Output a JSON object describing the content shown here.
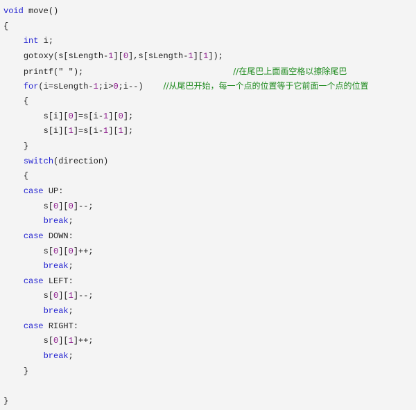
{
  "colors": {
    "background": "#f4f4f4",
    "keyword": "#1f1fd0",
    "number": "#8b1a8b",
    "comment": "#1e8a1e",
    "text": "#222222"
  },
  "code": {
    "language": "c",
    "lines": [
      {
        "indent": "",
        "tokens": [
          {
            "t": "kw",
            "v": "void"
          },
          {
            "t": "plain",
            "v": " move()"
          }
        ]
      },
      {
        "indent": "",
        "tokens": [
          {
            "t": "plain",
            "v": "{"
          }
        ]
      },
      {
        "indent": "    ",
        "tokens": [
          {
            "t": "kw",
            "v": "int"
          },
          {
            "t": "plain",
            "v": " i;"
          }
        ]
      },
      {
        "indent": "    ",
        "tokens": [
          {
            "t": "plain",
            "v": "gotoxy(s[sLength-"
          },
          {
            "t": "num",
            "v": "1"
          },
          {
            "t": "plain",
            "v": "]["
          },
          {
            "t": "num",
            "v": "0"
          },
          {
            "t": "plain",
            "v": "],s[sLength-"
          },
          {
            "t": "num",
            "v": "1"
          },
          {
            "t": "plain",
            "v": "]["
          },
          {
            "t": "num",
            "v": "1"
          },
          {
            "t": "plain",
            "v": "]);"
          }
        ]
      },
      {
        "indent": "    ",
        "tokens": [
          {
            "t": "plain",
            "v": "printf(\" \");                              "
          },
          {
            "t": "cm",
            "v": "//在尾巴上面画空格以擦除尾巴"
          }
        ]
      },
      {
        "indent": "    ",
        "tokens": [
          {
            "t": "kw",
            "v": "for"
          },
          {
            "t": "plain",
            "v": "(i=sLength-"
          },
          {
            "t": "num",
            "v": "1"
          },
          {
            "t": "plain",
            "v": ";i>"
          },
          {
            "t": "num",
            "v": "0"
          },
          {
            "t": "plain",
            "v": ";i--)    "
          },
          {
            "t": "cm",
            "v": "//从尾巴开始，每一个点的位置等于它前面一个点的位置"
          }
        ]
      },
      {
        "indent": "    ",
        "tokens": [
          {
            "t": "plain",
            "v": "{"
          }
        ]
      },
      {
        "indent": "        ",
        "tokens": [
          {
            "t": "plain",
            "v": "s[i]["
          },
          {
            "t": "num",
            "v": "0"
          },
          {
            "t": "plain",
            "v": "]=s[i-"
          },
          {
            "t": "num",
            "v": "1"
          },
          {
            "t": "plain",
            "v": "]["
          },
          {
            "t": "num",
            "v": "0"
          },
          {
            "t": "plain",
            "v": "];"
          }
        ]
      },
      {
        "indent": "        ",
        "tokens": [
          {
            "t": "plain",
            "v": "s[i]["
          },
          {
            "t": "num",
            "v": "1"
          },
          {
            "t": "plain",
            "v": "]=s[i-"
          },
          {
            "t": "num",
            "v": "1"
          },
          {
            "t": "plain",
            "v": "]["
          },
          {
            "t": "num",
            "v": "1"
          },
          {
            "t": "plain",
            "v": "];"
          }
        ]
      },
      {
        "indent": "    ",
        "tokens": [
          {
            "t": "plain",
            "v": "}"
          }
        ]
      },
      {
        "indent": "    ",
        "tokens": [
          {
            "t": "kw",
            "v": "switch"
          },
          {
            "t": "plain",
            "v": "(direction)"
          }
        ]
      },
      {
        "indent": "    ",
        "tokens": [
          {
            "t": "plain",
            "v": "{"
          }
        ]
      },
      {
        "indent": "    ",
        "tokens": [
          {
            "t": "kw",
            "v": "case"
          },
          {
            "t": "plain",
            "v": " UP:"
          }
        ]
      },
      {
        "indent": "        ",
        "tokens": [
          {
            "t": "plain",
            "v": "s["
          },
          {
            "t": "num",
            "v": "0"
          },
          {
            "t": "plain",
            "v": "]["
          },
          {
            "t": "num",
            "v": "0"
          },
          {
            "t": "plain",
            "v": "]--;"
          }
        ]
      },
      {
        "indent": "        ",
        "tokens": [
          {
            "t": "kw",
            "v": "break"
          },
          {
            "t": "plain",
            "v": ";"
          }
        ]
      },
      {
        "indent": "    ",
        "tokens": [
          {
            "t": "kw",
            "v": "case"
          },
          {
            "t": "plain",
            "v": " DOWN:"
          }
        ]
      },
      {
        "indent": "        ",
        "tokens": [
          {
            "t": "plain",
            "v": "s["
          },
          {
            "t": "num",
            "v": "0"
          },
          {
            "t": "plain",
            "v": "]["
          },
          {
            "t": "num",
            "v": "0"
          },
          {
            "t": "plain",
            "v": "]++;"
          }
        ]
      },
      {
        "indent": "        ",
        "tokens": [
          {
            "t": "kw",
            "v": "break"
          },
          {
            "t": "plain",
            "v": ";"
          }
        ]
      },
      {
        "indent": "    ",
        "tokens": [
          {
            "t": "kw",
            "v": "case"
          },
          {
            "t": "plain",
            "v": " LEFT:"
          }
        ]
      },
      {
        "indent": "        ",
        "tokens": [
          {
            "t": "plain",
            "v": "s["
          },
          {
            "t": "num",
            "v": "0"
          },
          {
            "t": "plain",
            "v": "]["
          },
          {
            "t": "num",
            "v": "1"
          },
          {
            "t": "plain",
            "v": "]--;"
          }
        ]
      },
      {
        "indent": "        ",
        "tokens": [
          {
            "t": "kw",
            "v": "break"
          },
          {
            "t": "plain",
            "v": ";"
          }
        ]
      },
      {
        "indent": "    ",
        "tokens": [
          {
            "t": "kw",
            "v": "case"
          },
          {
            "t": "plain",
            "v": " RIGHT:"
          }
        ]
      },
      {
        "indent": "        ",
        "tokens": [
          {
            "t": "plain",
            "v": "s["
          },
          {
            "t": "num",
            "v": "0"
          },
          {
            "t": "plain",
            "v": "]["
          },
          {
            "t": "num",
            "v": "1"
          },
          {
            "t": "plain",
            "v": "]++;"
          }
        ]
      },
      {
        "indent": "        ",
        "tokens": [
          {
            "t": "kw",
            "v": "break"
          },
          {
            "t": "plain",
            "v": ";"
          }
        ]
      },
      {
        "indent": "    ",
        "tokens": [
          {
            "t": "plain",
            "v": "}"
          }
        ]
      },
      {
        "indent": "",
        "tokens": []
      },
      {
        "indent": "",
        "tokens": [
          {
            "t": "plain",
            "v": "}"
          }
        ]
      }
    ]
  }
}
